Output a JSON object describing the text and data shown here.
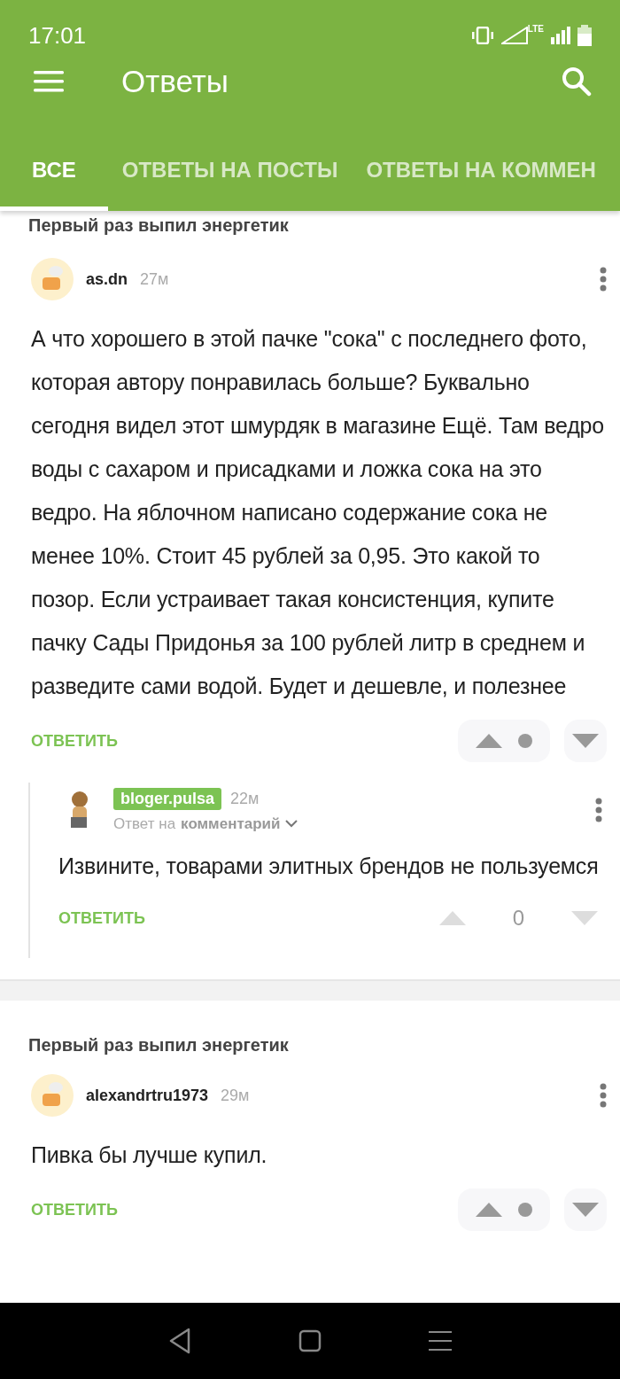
{
  "status_bar": {
    "time": "17:01",
    "network": "LTE"
  },
  "toolbar": {
    "title": "Ответы"
  },
  "tabs": [
    {
      "label": "ВСЕ",
      "selected": true
    },
    {
      "label": "ОТВЕТЫ НА ПОСТЫ",
      "selected": false
    },
    {
      "label": "ОТВЕТЫ НА КОММЕН",
      "selected": false
    }
  ],
  "feed": [
    {
      "post_title": "Первый раз выпил энергетик",
      "comment": {
        "author": "as.dn",
        "author_highlighted": false,
        "time": "27м",
        "text": "А что хорошего в этой пачке \"сока\" с последнего фото, которая автору понравилась больше? Буквально сегодня видел этот шмурдяк в магазине Ещё. Там ведро воды с сахаром и присадками и ложка сока на это ведро. На яблочном написано содержание сока не менее 10%. Стоит 45 рублей за 0,95. Это какой то позор. Если устраивает такая консистенция, купите пачку Сады Придонья за 100 рублей литр в среднем и разведите сами водой. Будет и дешевле, и полезнее",
        "reply_label": "ОТВЕТИТЬ",
        "votes": {
          "kind": "hidden"
        }
      },
      "replies": [
        {
          "author": "bloger.pulsa",
          "author_highlighted": true,
          "time": "22м",
          "reply_to": "Ответ на",
          "reply_to_target": "комментарий",
          "text": "Извините, товарами элитных брендов не пользуемся",
          "reply_label": "ОТВЕТИТЬ",
          "votes": {
            "kind": "score",
            "score": "0"
          }
        }
      ]
    },
    {
      "post_title": "Первый раз выпил энергетик",
      "comment": {
        "author": "alexandrtru1973",
        "author_highlighted": false,
        "time": "29м",
        "text": "Пивка бы лучше купил.",
        "reply_label": "ОТВЕТИТЬ",
        "votes": {
          "kind": "hidden"
        }
      }
    }
  ]
}
